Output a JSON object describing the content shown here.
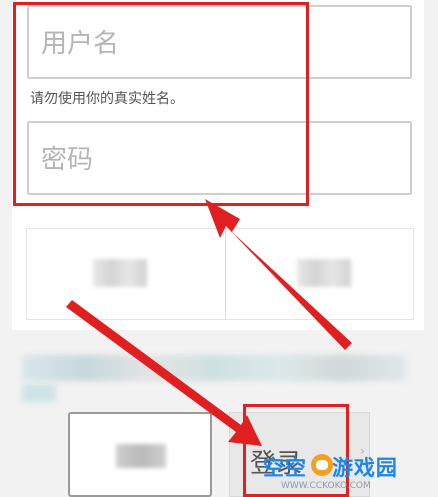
{
  "form": {
    "username_placeholder": "用户名",
    "username_hint": "请勿使用你的真实姓名。",
    "password_placeholder": "密码"
  },
  "buttons": {
    "right_label": "登录"
  },
  "watermark": {
    "text": "空空",
    "text2": "游戏园",
    "url": "WWW.CCKOKO.COM"
  },
  "annotations": {
    "box_color": "#e02020",
    "arrow_color": "#e02020"
  }
}
